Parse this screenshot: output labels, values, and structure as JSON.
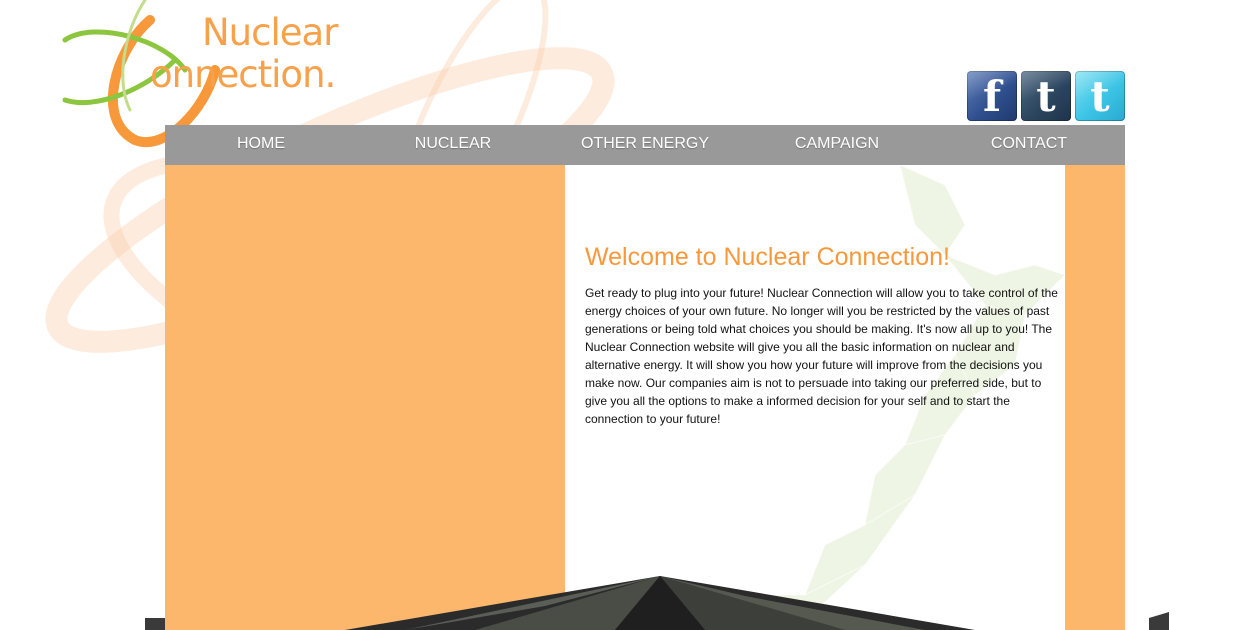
{
  "logo": {
    "line1": "Nuclear",
    "line2": "onnection."
  },
  "social": [
    {
      "label": "f",
      "icon": "facebook-icon"
    },
    {
      "label": "t",
      "icon": "tumblr-icon"
    },
    {
      "label": "t",
      "icon": "twitter-icon"
    }
  ],
  "nav": {
    "items": [
      "HOME",
      "NUCLEAR",
      "OTHER ENERGY",
      "CAMPAIGN",
      "CONTACT"
    ]
  },
  "main": {
    "title": "Welcome to Nuclear Connection!",
    "body": "Get ready to plug into your future! Nuclear Connection will allow you to take control of the energy choices of your own future. No longer will you be restricted by the values of past generations or being told what choices you should be making. It's now all up to you! The Nuclear Connection website will give you all the basic information on nuclear and alternative energy. It will show you how your future will improve from the decisions you make now. Our companies aim is not to persuade into taking our preferred side, but to give you all the options to make a informed decision for your self and to start the connection to your future!"
  },
  "colors": {
    "accent_orange": "#f7983a",
    "column_orange": "#fdb76d",
    "nav_gray": "#999999",
    "logo_green": "#8cc63f"
  }
}
